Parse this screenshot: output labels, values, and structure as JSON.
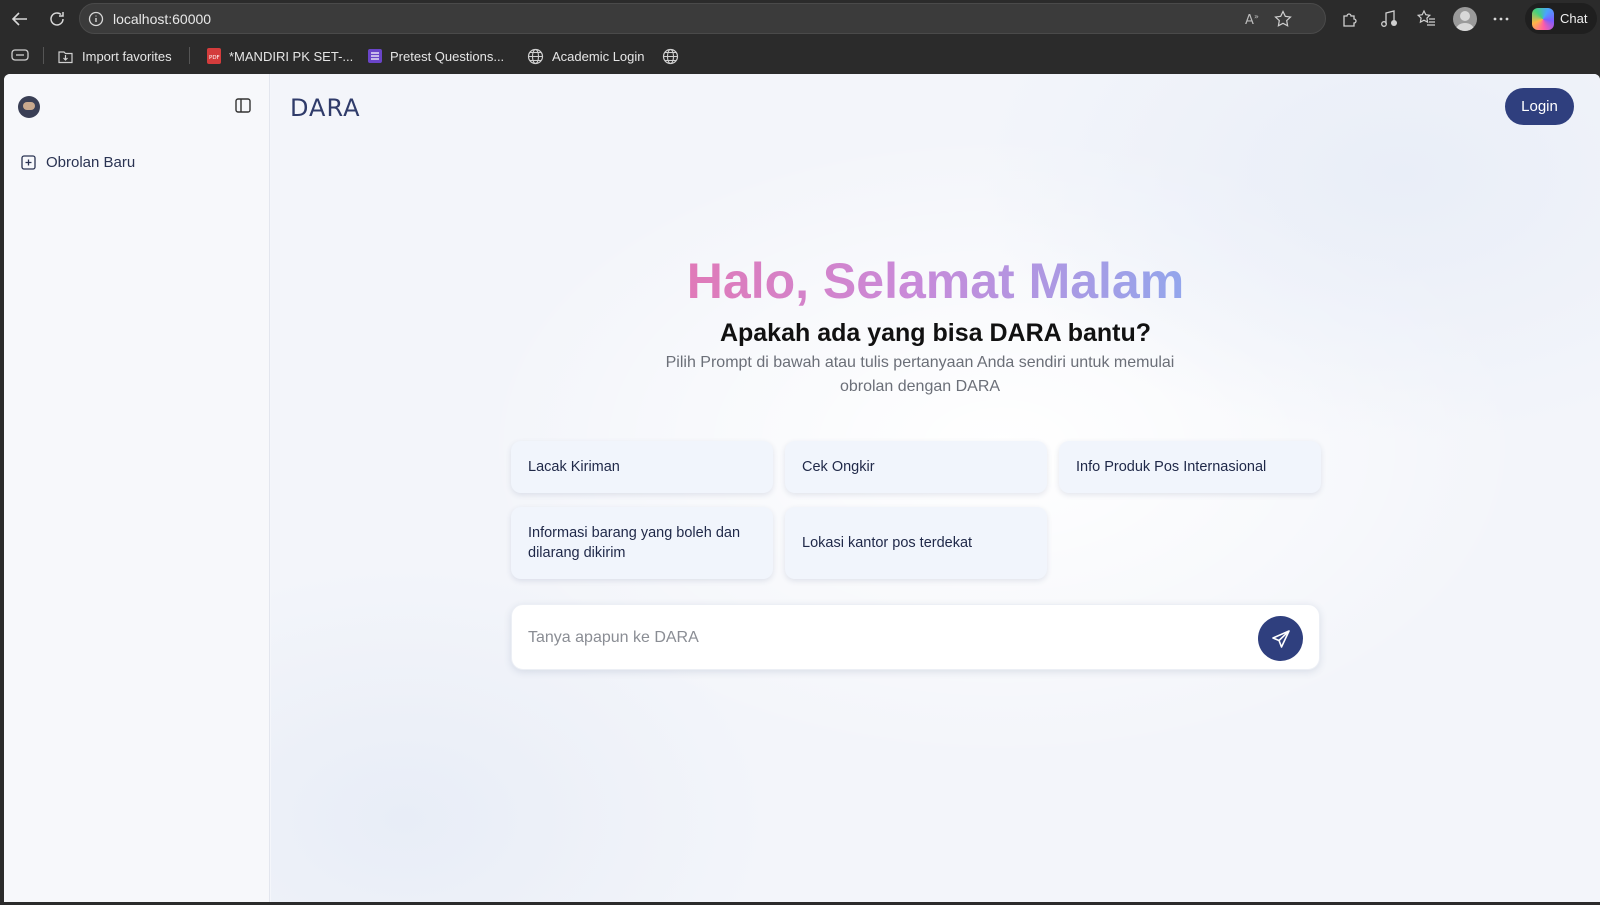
{
  "browser": {
    "url": "localhost:60000",
    "chat_label": "Chat",
    "favorites": [
      {
        "label": "Import favorites",
        "icon": "import-icon"
      },
      {
        "label": "*MANDIRI PK SET-...",
        "icon": "pdf-icon"
      },
      {
        "label": "Pretest Questions...",
        "icon": "list-icon"
      },
      {
        "label": "Academic Login",
        "icon": "globe-icon"
      }
    ]
  },
  "sidebar": {
    "new_chat_label": "Obrolan Baru"
  },
  "header": {
    "brand": "DARA",
    "login_label": "Login"
  },
  "hero": {
    "greeting": "Halo, Selamat Malam",
    "question": "Apakah ada yang bisa DARA bantu?",
    "description": "Pilih Prompt di bawah atau tulis pertanyaan Anda sendiri untuk memulai obrolan dengan DARA"
  },
  "prompts": [
    "Lacak Kiriman",
    "Cek Ongkir",
    "Info Produk Pos Internasional",
    "Informasi barang yang boleh dan dilarang dikirim",
    "Lokasi kantor pos terdekat"
  ],
  "input": {
    "placeholder": "Tanya apapun ke DARA",
    "value": ""
  },
  "colors": {
    "accent": "#2f3f7e",
    "gradient_start": "#e07ab8",
    "gradient_end": "#93a6ec"
  }
}
